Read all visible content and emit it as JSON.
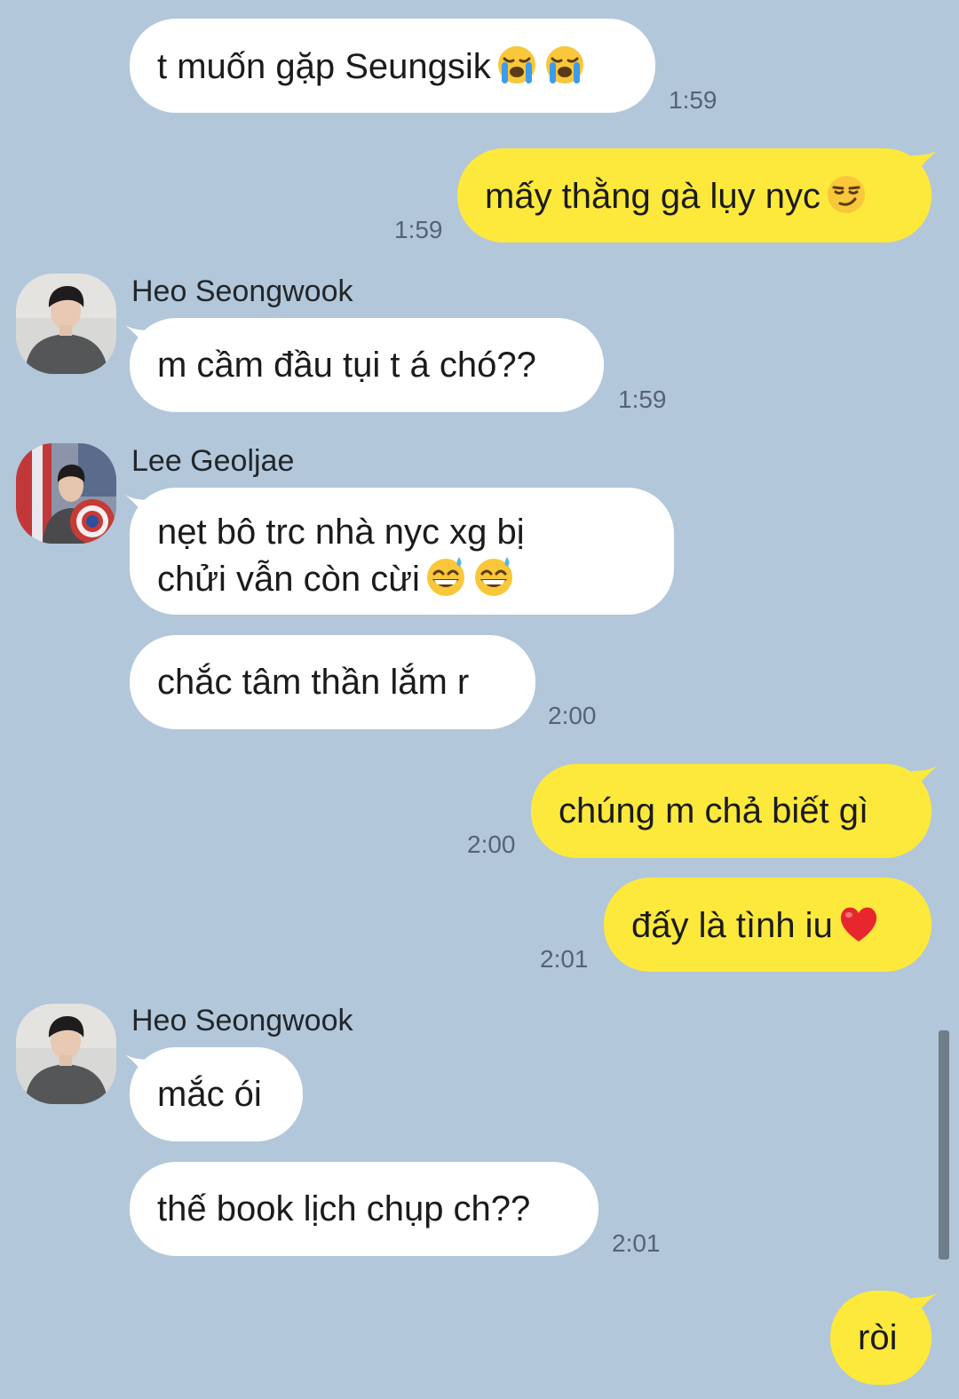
{
  "colors": {
    "background": "#b2c7da",
    "incoming_bubble": "#ffffff",
    "outgoing_bubble": "#fde93b",
    "timestamp": "#556473"
  },
  "messages": [
    {
      "direction": "in",
      "text": "t muốn gặp Seungsik",
      "emojis": [
        "loudly-crying-face",
        "loudly-crying-face"
      ],
      "time": "1:59"
    },
    {
      "direction": "out",
      "text": "mấy thằng gà lụy nyc",
      "emojis": [
        "smirking-face"
      ],
      "time": "1:59"
    },
    {
      "direction": "in",
      "sender": "Heo Seongwook",
      "text": "m cầm đầu tụi t á chó??",
      "time": "1:59"
    },
    {
      "direction": "in",
      "sender": "Lee Geoljae",
      "text_line1": "nẹt bô trc nhà nyc xg bị",
      "text_line2": "chửi vẫn còn cừi",
      "emojis": [
        "grinning-sweat-face",
        "grinning-sweat-face"
      ]
    },
    {
      "direction": "in",
      "text": "chắc tâm thần lắm r",
      "time": "2:00"
    },
    {
      "direction": "out",
      "text": "chúng m chả biết gì",
      "time": "2:00"
    },
    {
      "direction": "out",
      "text": "đấy là tình iu",
      "emojis": [
        "red-heart"
      ],
      "time": "2:01"
    },
    {
      "direction": "in",
      "sender": "Heo Seongwook",
      "text": "mắc ói"
    },
    {
      "direction": "in",
      "text": "thế book lịch chụp ch??",
      "time": "2:01"
    },
    {
      "direction": "out",
      "text": "ròi"
    }
  ]
}
